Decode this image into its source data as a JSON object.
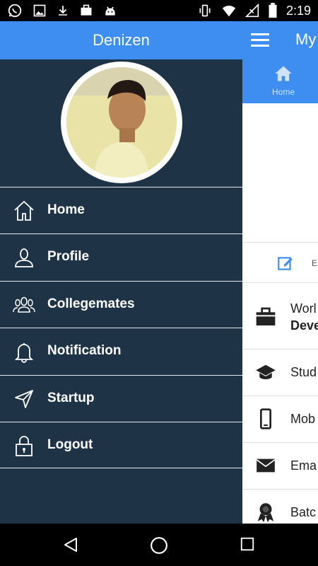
{
  "status_bar": {
    "time": "2:19",
    "icons": [
      "whatsapp-icon",
      "image-icon",
      "download-icon",
      "briefcase-icon",
      "android-icon",
      "vibrate-icon",
      "wifi-icon",
      "signal-icon",
      "battery-icon"
    ]
  },
  "drawer": {
    "title": "Denizen",
    "items": [
      {
        "label": "Home",
        "icon": "home-icon"
      },
      {
        "label": "Profile",
        "icon": "profile-icon"
      },
      {
        "label": "Collegemates",
        "icon": "collegemates-icon"
      },
      {
        "label": "Notification",
        "icon": "bell-icon"
      },
      {
        "label": "Startup",
        "icon": "send-icon"
      },
      {
        "label": "Logout",
        "icon": "lock-icon"
      }
    ]
  },
  "main": {
    "title": "My",
    "tab_home": "Home",
    "edit_label": "E",
    "rows": [
      {
        "line1": "Worl",
        "line2": "Deve",
        "icon": "briefcase-icon"
      },
      {
        "line1": "Stud",
        "icon": "graduation-cap-icon"
      },
      {
        "line1": "Mob",
        "icon": "mobile-icon"
      },
      {
        "line1": "Ema",
        "icon": "email-icon"
      },
      {
        "line1": "Batc",
        "icon": "badge-icon"
      }
    ]
  },
  "colors": {
    "accent": "#3d8ef0",
    "drawer_bg": "#1f3347"
  }
}
